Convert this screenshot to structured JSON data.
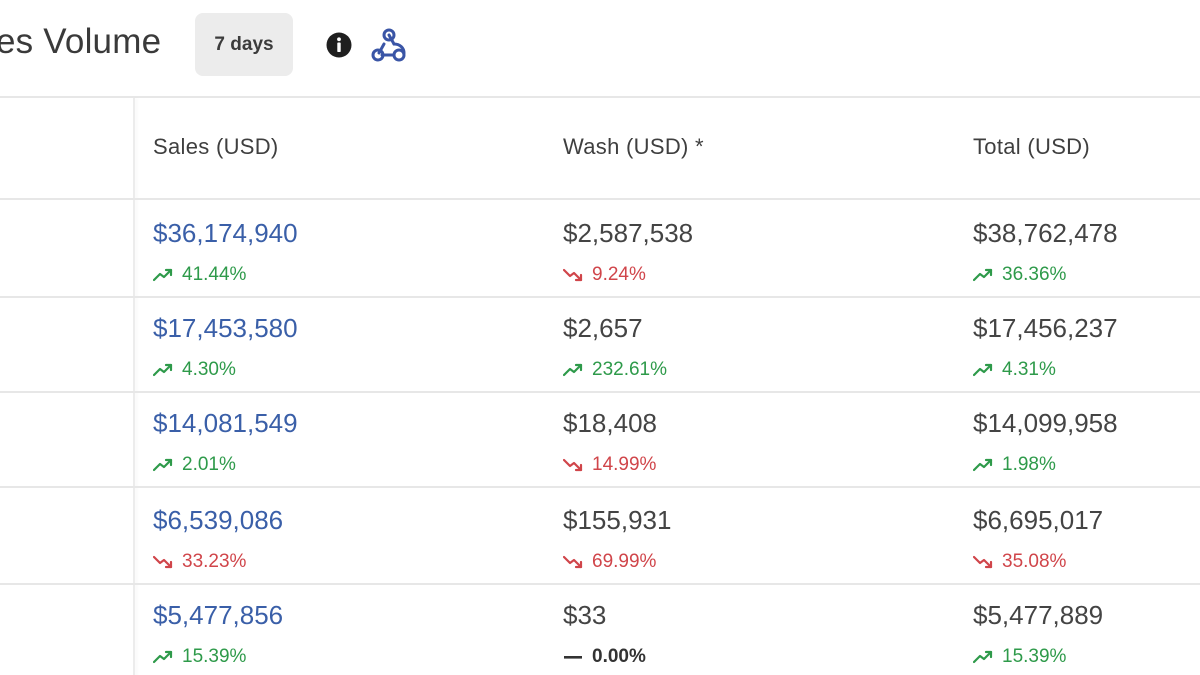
{
  "header": {
    "title": "es Volume",
    "period_label": "7 days",
    "info_icon": "info-icon",
    "webhook_icon": "webhook-icon"
  },
  "table": {
    "columns": [
      "Sales (USD)",
      "Wash (USD) *",
      "Total (USD)"
    ],
    "rows": [
      {
        "sales": {
          "amount": "$36,174,940",
          "change": "41.44%",
          "trend": "up"
        },
        "wash": {
          "amount": "$2,587,538",
          "change": "9.24%",
          "trend": "down"
        },
        "total": {
          "amount": "$38,762,478",
          "change": "36.36%",
          "trend": "up"
        }
      },
      {
        "sales": {
          "amount": "$17,453,580",
          "change": "4.30%",
          "trend": "up"
        },
        "wash": {
          "amount": "$2,657",
          "change": "232.61%",
          "trend": "up"
        },
        "total": {
          "amount": "$17,456,237",
          "change": "4.31%",
          "trend": "up"
        }
      },
      {
        "sales": {
          "amount": "$14,081,549",
          "change": "2.01%",
          "trend": "up"
        },
        "wash": {
          "amount": "$18,408",
          "change": "14.99%",
          "trend": "down"
        },
        "total": {
          "amount": "$14,099,958",
          "change": "1.98%",
          "trend": "up"
        }
      },
      {
        "sales": {
          "amount": "$6,539,086",
          "change": "33.23%",
          "trend": "down"
        },
        "wash": {
          "amount": "$155,931",
          "change": "69.99%",
          "trend": "down"
        },
        "total": {
          "amount": "$6,695,017",
          "change": "35.08%",
          "trend": "down"
        }
      },
      {
        "sales": {
          "amount": "$5,477,856",
          "change": "15.39%",
          "trend": "up"
        },
        "wash": {
          "amount": "$33",
          "change": "0.00%",
          "trend": "flat"
        },
        "total": {
          "amount": "$5,477,889",
          "change": "15.39%",
          "trend": "up"
        }
      }
    ]
  },
  "colors": {
    "link": "#3a5fa8",
    "up": "#2e9a4a",
    "down": "#d0454a"
  }
}
